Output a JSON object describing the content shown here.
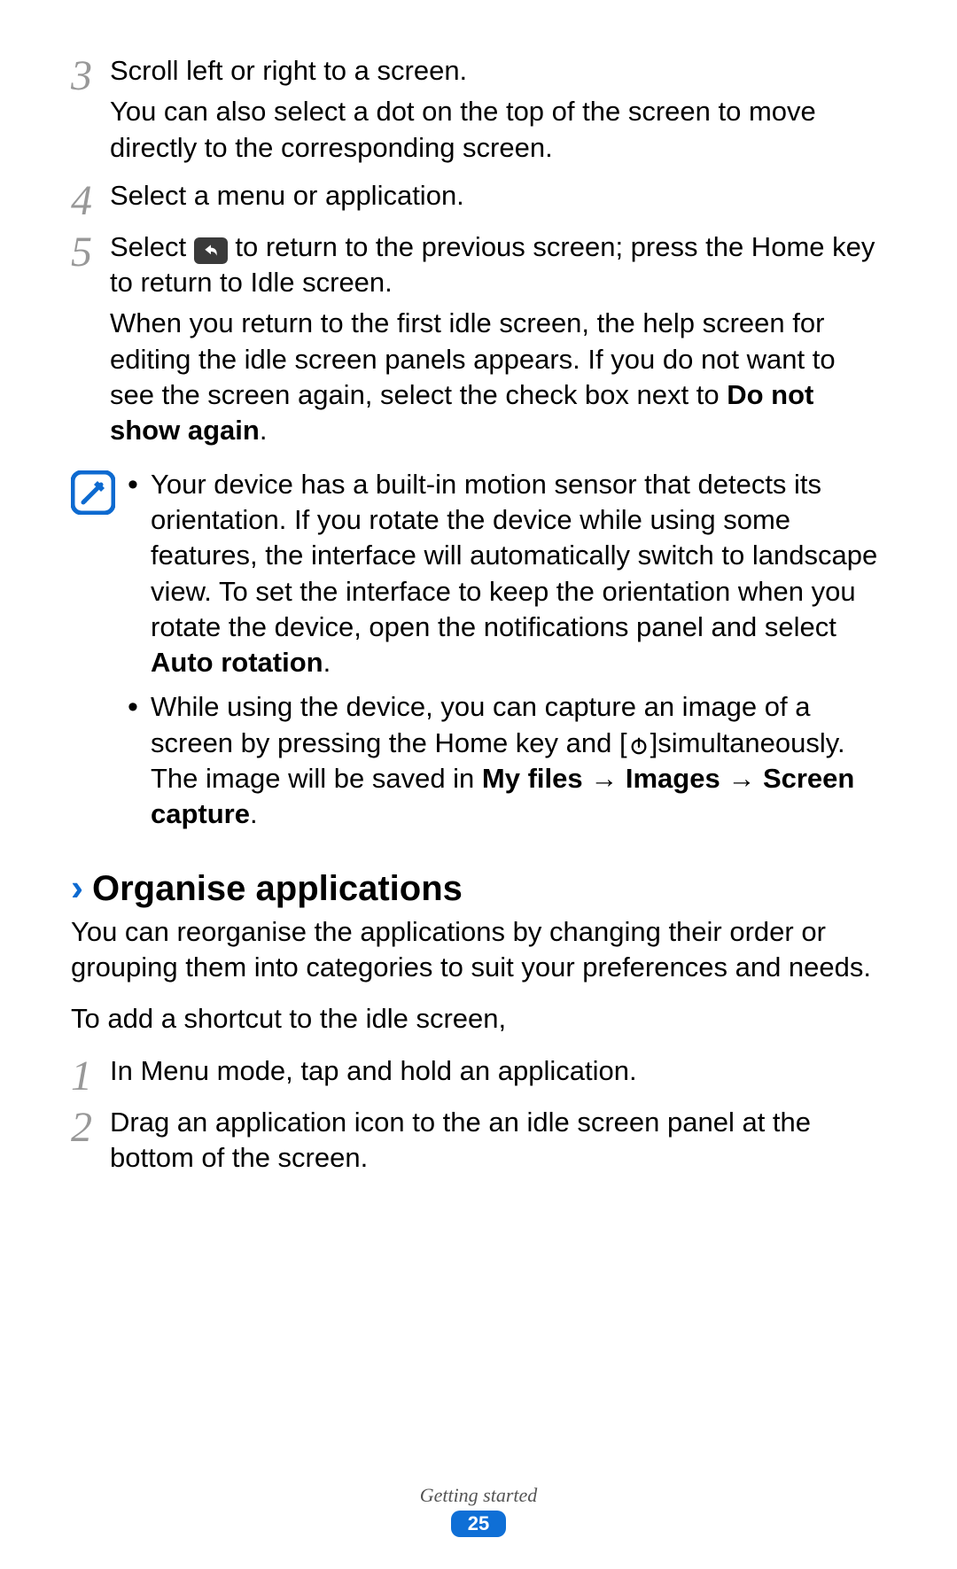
{
  "steps_a": [
    {
      "num": "3",
      "para1": "Scroll left or right to a screen.",
      "para2": "You can also select a dot on the top of the screen to move directly to the corresponding screen."
    },
    {
      "num": "4",
      "para1": "Select a menu or application."
    }
  ],
  "step5": {
    "num": "5",
    "pre_icon": "Select ",
    "post_icon": " to return to the previous screen; press the Home key to return to Idle screen.",
    "para2_pre": "When you return to the first idle screen, the help screen for editing the idle screen panels appears. If you do not want to see the screen again, select the check box next to ",
    "para2_bold": "Do not show again",
    "para2_post": "."
  },
  "notes": {
    "item1_pre": "Your device has a built-in motion sensor that detects its orientation. If you rotate the device while using some features, the interface will automatically switch to landscape view. To set the interface to keep the orientation when you rotate the device, open the notifications panel and select ",
    "item1_bold": "Auto rotation",
    "item1_post": ".",
    "item2_pre": "While using the device, you can capture an image of a screen by pressing the Home key and [",
    "item2_mid": "]simultaneously. The image will be saved in ",
    "item2_bold1": "My files",
    "item2_arrow": " → ",
    "item2_bold2": "Images",
    "item2_bold3": "Screen capture",
    "item2_post": "."
  },
  "section": {
    "title": "Organise applications",
    "intro": "You can reorganise the applications by changing their order or grouping them into categories to suit your preferences and needs.",
    "lead": "To add a shortcut to the idle screen,"
  },
  "steps_b": [
    {
      "num": "1",
      "text": "In Menu mode, tap and hold an application."
    },
    {
      "num": "2",
      "text": "Drag an application icon to the an idle screen panel at the bottom of the screen."
    }
  ],
  "footer": {
    "section": "Getting started",
    "page": "25"
  }
}
